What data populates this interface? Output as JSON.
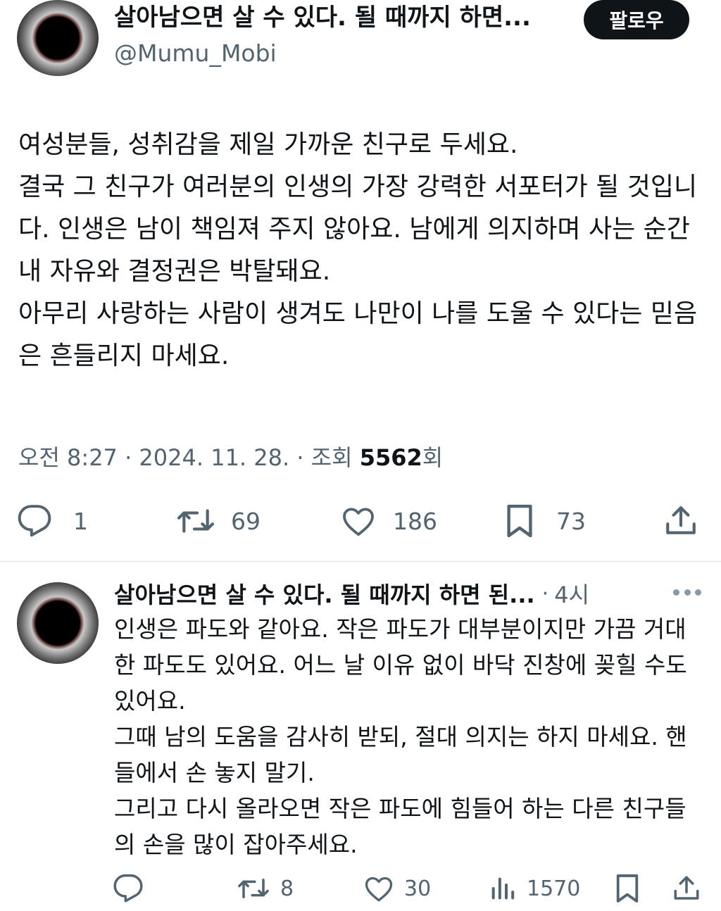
{
  "tweet": {
    "author_name": "살아남으면 살 수 있다. 될 때까지 하면...",
    "author_handle": "@Mumu_Mobi",
    "follow_label": "팔로우",
    "text_lines": [
      "여성분들, 성취감을 제일 가까운 친구로 두세요.",
      "결국 그 친구가 여러분의 인생의 가장 강력한 서포터가 될 것입니다. 인생은 남이 책임져 주지 않아요. 남에게 의지하며 사는 순간 내 자유와 결정권은 박탈돼요.",
      "아무리 사랑하는 사람이 생겨도 나만이 나를 도울 수 있다는 믿음은 흔들리지 마세요."
    ],
    "meta_prefix": "오전 8:27 · 2024. 11. 28. · 조회 ",
    "views": "5562",
    "views_suffix": "회",
    "counts": {
      "replies": "1",
      "retweets": "69",
      "likes": "186",
      "bookmarks": "73"
    }
  },
  "reply": {
    "author_name": "살아남으면 살 수 있다. 될 때까지 하면 된...",
    "separator": "·",
    "time": "4시",
    "text_lines": [
      "인생은 파도와 같아요. 작은 파도가 대부분이지만 가끔 거대한 파도도 있어요. 어느 날 이유 없이 바닥 진창에 꽂힐 수도 있어요.",
      "그때 남의 도움을 감사히 받되, 절대 의지는 하지 마세요. 핸들에서 손 놓지 말기.",
      "그리고 다시 올라오면 작은 파도에 힘들어 하는 다른 친구들의 손을 많이 잡아주세요."
    ],
    "counts": {
      "retweets": "8",
      "likes": "30",
      "views": "1570"
    }
  },
  "icons": [
    "reply-icon",
    "retweet-icon",
    "like-icon",
    "bookmark-icon",
    "share-icon",
    "views-icon",
    "more-icon"
  ],
  "colors": {
    "text": "#0f1419",
    "secondary": "#536471",
    "follow_bg": "#0f1419",
    "divider": "#dfe3e6"
  }
}
